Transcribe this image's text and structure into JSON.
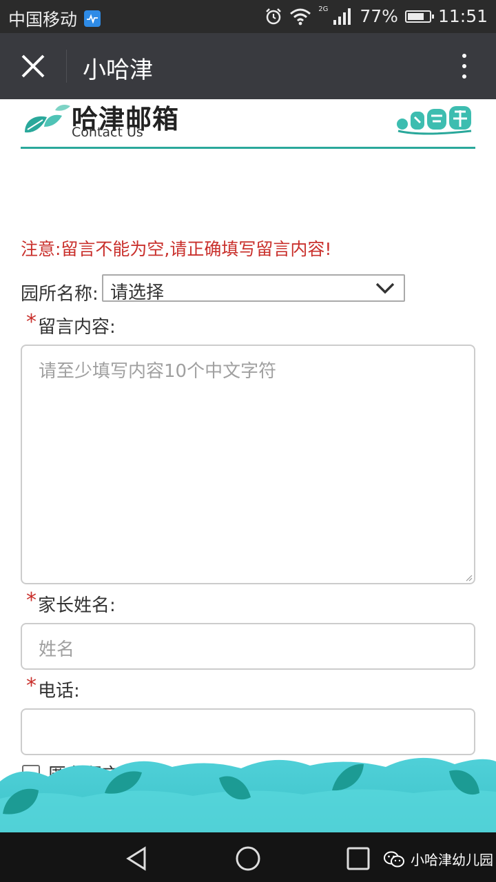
{
  "status_bar": {
    "carrier": "中国移动",
    "network": "2G",
    "battery_percent": "77%",
    "battery_level": 0.77,
    "time": "11:51"
  },
  "title_bar": {
    "title": "小哈津",
    "close_icon": "close-icon",
    "more_icon": "more-vertical-icon"
  },
  "page_header": {
    "title": "哈津邮箱",
    "subtitle": "Contact Us",
    "accent_color": "#2aa89b"
  },
  "form": {
    "notice": "注意:留言不能为空,请正确填写留言内容!",
    "notice_color": "#c9302c",
    "school": {
      "label": "园所名称:",
      "selected": "请选择"
    },
    "message": {
      "required_mark": "*",
      "label": "留言内容:",
      "placeholder": "请至少填写内容10个中文字符",
      "value": ""
    },
    "parent_name": {
      "required_mark": "*",
      "label": "家长姓名:",
      "placeholder": "姓名",
      "value": ""
    },
    "phone": {
      "required_mark": "*",
      "label": "电话:",
      "placeholder": "",
      "value": ""
    },
    "anonymous": {
      "label": "匿名留言",
      "checked": false
    }
  },
  "nav_bar": {
    "back_icon": "back-icon",
    "home_icon": "home-icon",
    "recent_icon": "recent-apps-icon"
  },
  "watermark": {
    "text": "小哈津幼儿园",
    "icon": "wechat-icon"
  }
}
